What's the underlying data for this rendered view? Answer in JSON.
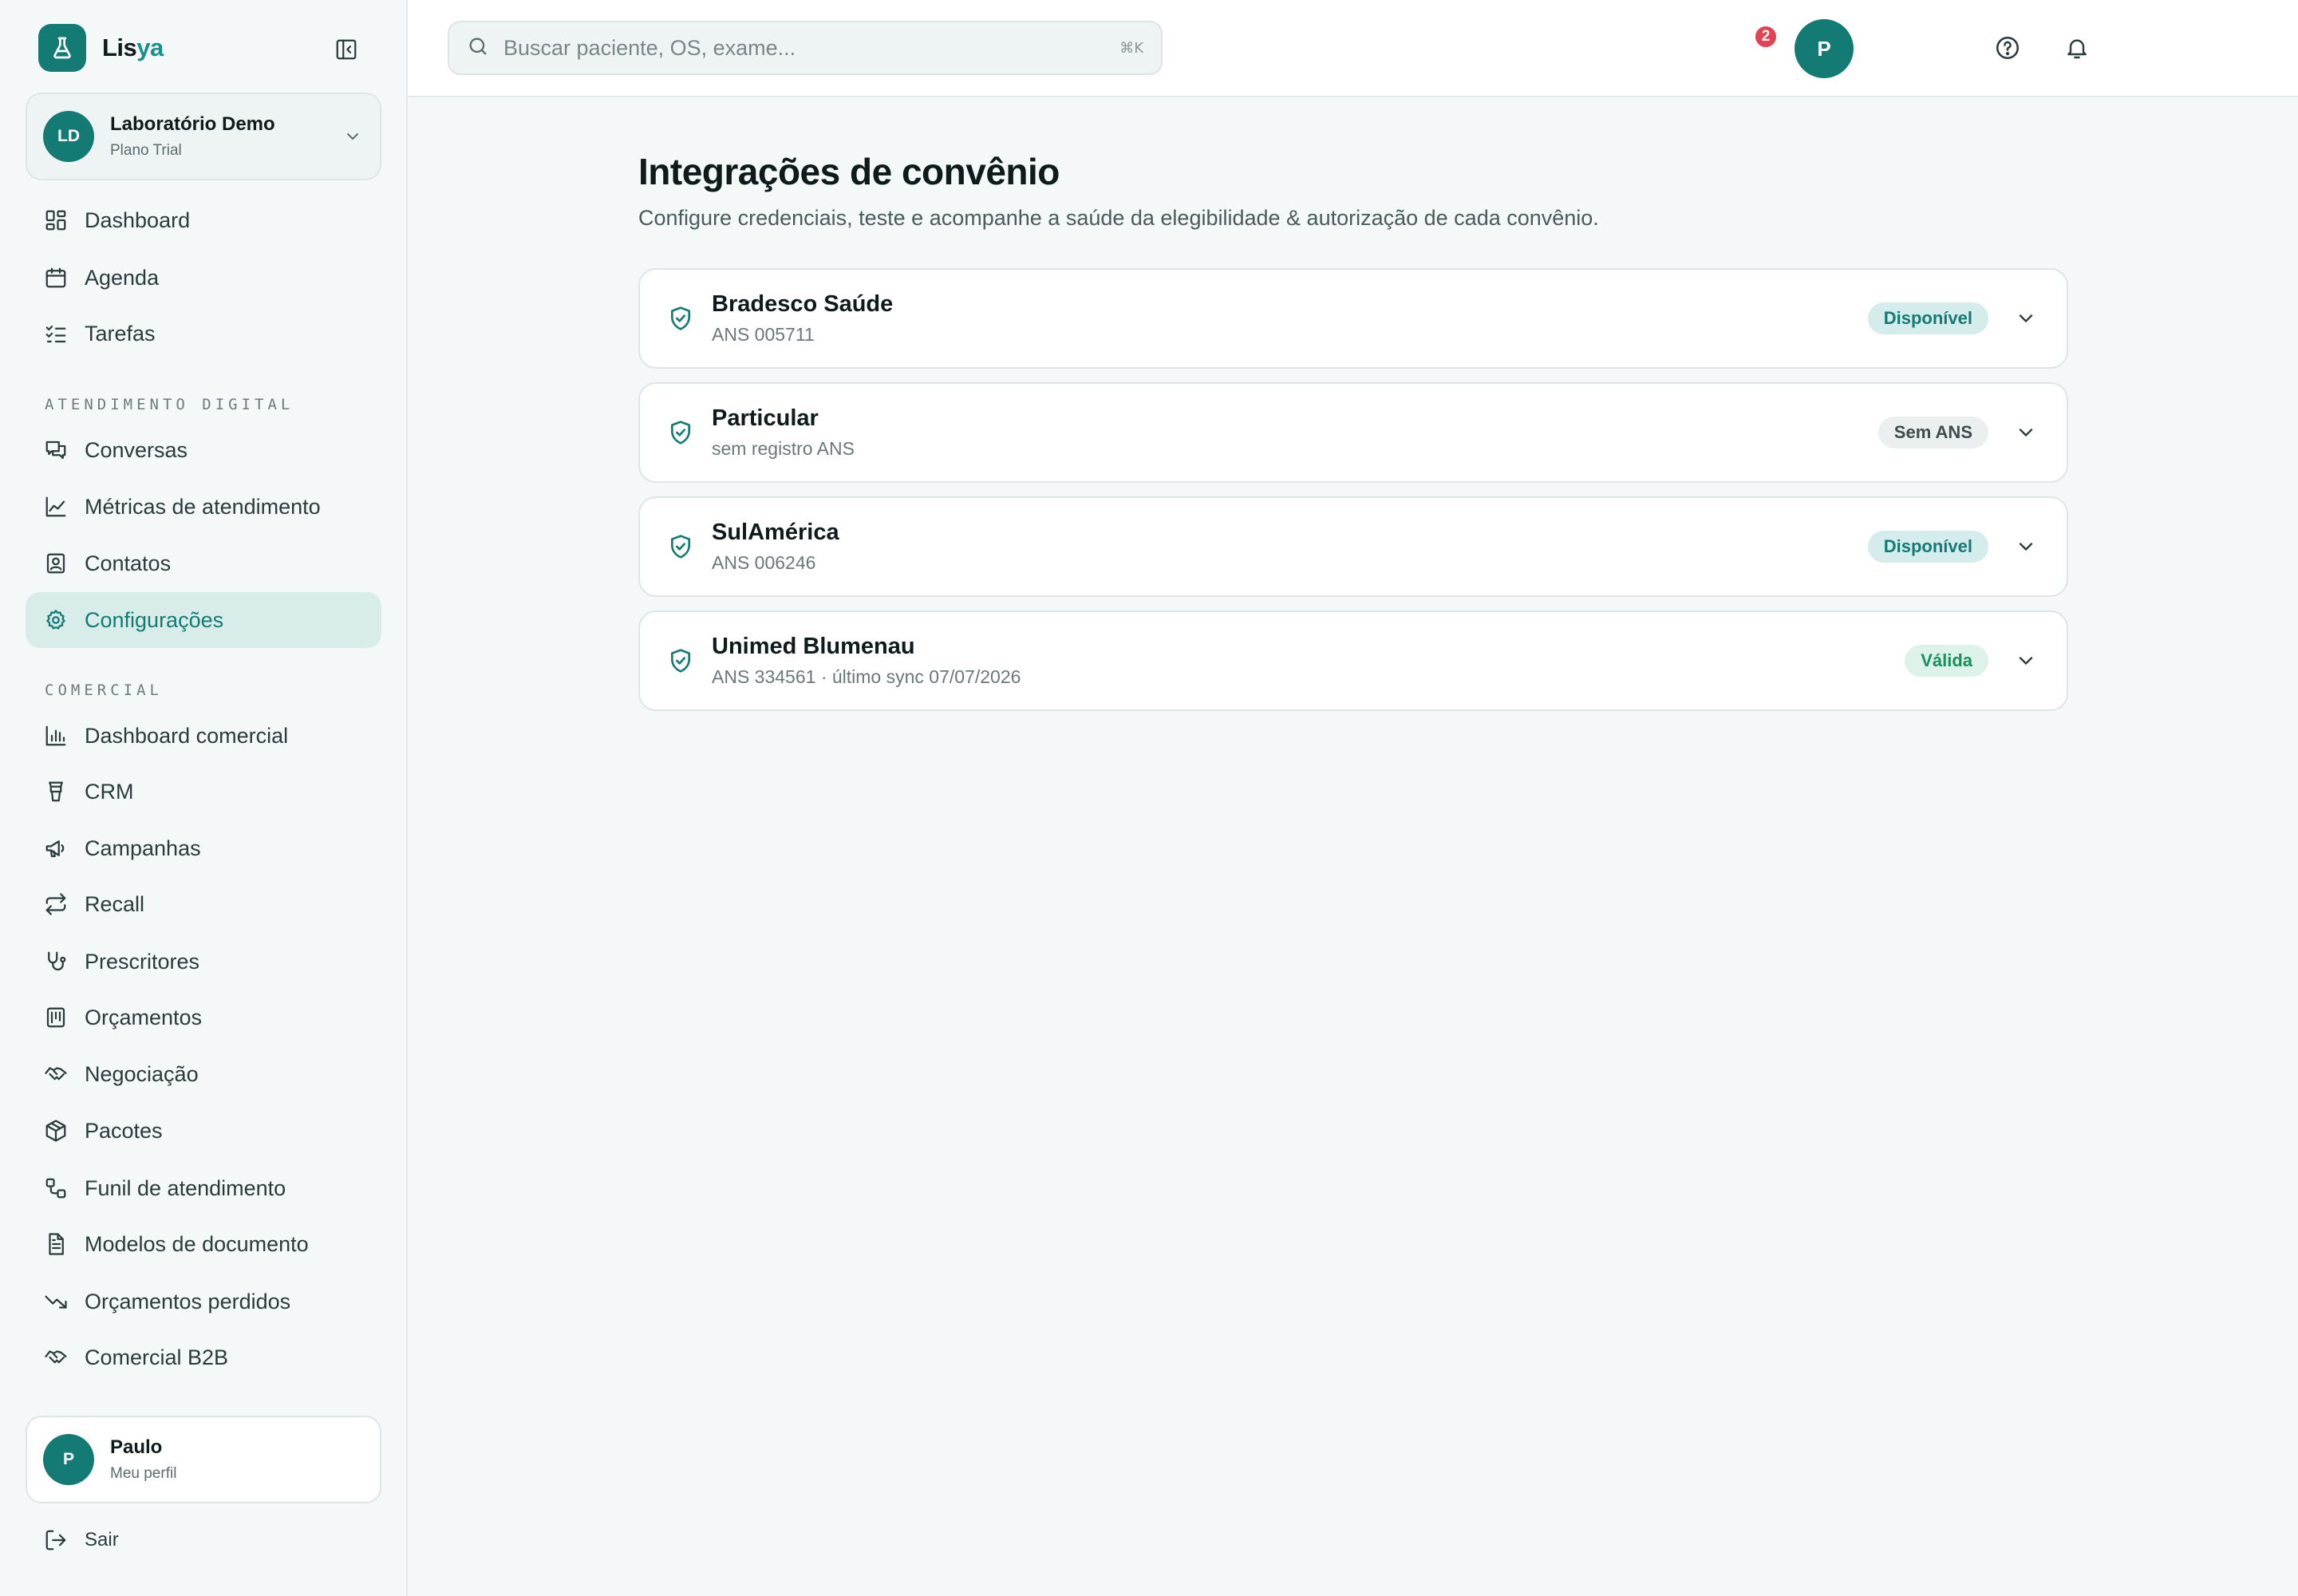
{
  "brand": {
    "name_prefix": "Lis",
    "name_accent": "ya"
  },
  "org": {
    "initials": "LD",
    "name": "Laboratório Demo",
    "plan": "Plano Trial"
  },
  "sidebar": {
    "top_items": [
      {
        "label": "Dashboard",
        "icon": "dashboard-icon"
      },
      {
        "label": "Agenda",
        "icon": "calendar-icon"
      },
      {
        "label": "Tarefas",
        "icon": "checklist-icon"
      }
    ],
    "section_digital": "ATENDIMENTO DIGITAL",
    "digital_items": [
      {
        "label": "Conversas",
        "icon": "chat-icon"
      },
      {
        "label": "Métricas de atendimento",
        "icon": "line-chart-icon"
      },
      {
        "label": "Contatos",
        "icon": "contact-icon"
      },
      {
        "label": "Configurações",
        "icon": "gear-icon",
        "active": true
      }
    ],
    "section_comercial": "COMERCIAL",
    "comercial_items": [
      {
        "label": "Dashboard comercial",
        "icon": "bar-chart-icon"
      },
      {
        "label": "CRM",
        "icon": "funnel-icon"
      },
      {
        "label": "Campanhas",
        "icon": "megaphone-icon"
      },
      {
        "label": "Recall",
        "icon": "repeat-icon"
      },
      {
        "label": "Prescritores",
        "icon": "stethoscope-icon"
      },
      {
        "label": "Orçamentos",
        "icon": "calculator-icon"
      },
      {
        "label": "Negociação",
        "icon": "handshake-icon"
      },
      {
        "label": "Pacotes",
        "icon": "package-icon"
      },
      {
        "label": "Funil de atendimento",
        "icon": "workflow-icon"
      },
      {
        "label": "Modelos de documento",
        "icon": "document-icon"
      },
      {
        "label": "Orçamentos perdidos",
        "icon": "trending-down-icon"
      },
      {
        "label": "Comercial B2B",
        "icon": "handshake-icon"
      }
    ],
    "profile": {
      "initial": "P",
      "name": "Paulo",
      "link": "Meu perfil"
    },
    "logout_label": "Sair"
  },
  "topbar": {
    "search_placeholder": "Buscar paciente, OS, exame...",
    "search_shortcut": "⌘K",
    "notification_count": "2",
    "user_initial": "P"
  },
  "main": {
    "title": "Integrações de convênio",
    "subtitle": "Configure credenciais, teste e acompanhe a saúde da elegibilidade & autorização de cada convênio.",
    "integrations": [
      {
        "name": "Bradesco Saúde",
        "detail": "ANS 005711",
        "status": "Disponível",
        "status_style": "teal"
      },
      {
        "name": "Particular",
        "detail": "sem registro ANS",
        "status": "Sem ANS",
        "status_style": "gray"
      },
      {
        "name": "SulAmérica",
        "detail": "ANS 006246",
        "status": "Disponível",
        "status_style": "teal"
      },
      {
        "name": "Unimed Blumenau",
        "detail": "ANS 334561 · último sync 07/07/2026",
        "status": "Válida",
        "status_style": "green"
      }
    ]
  },
  "colors": {
    "primary": "#137a74",
    "accent_text": "#17918a",
    "badge_red": "#e04453"
  }
}
